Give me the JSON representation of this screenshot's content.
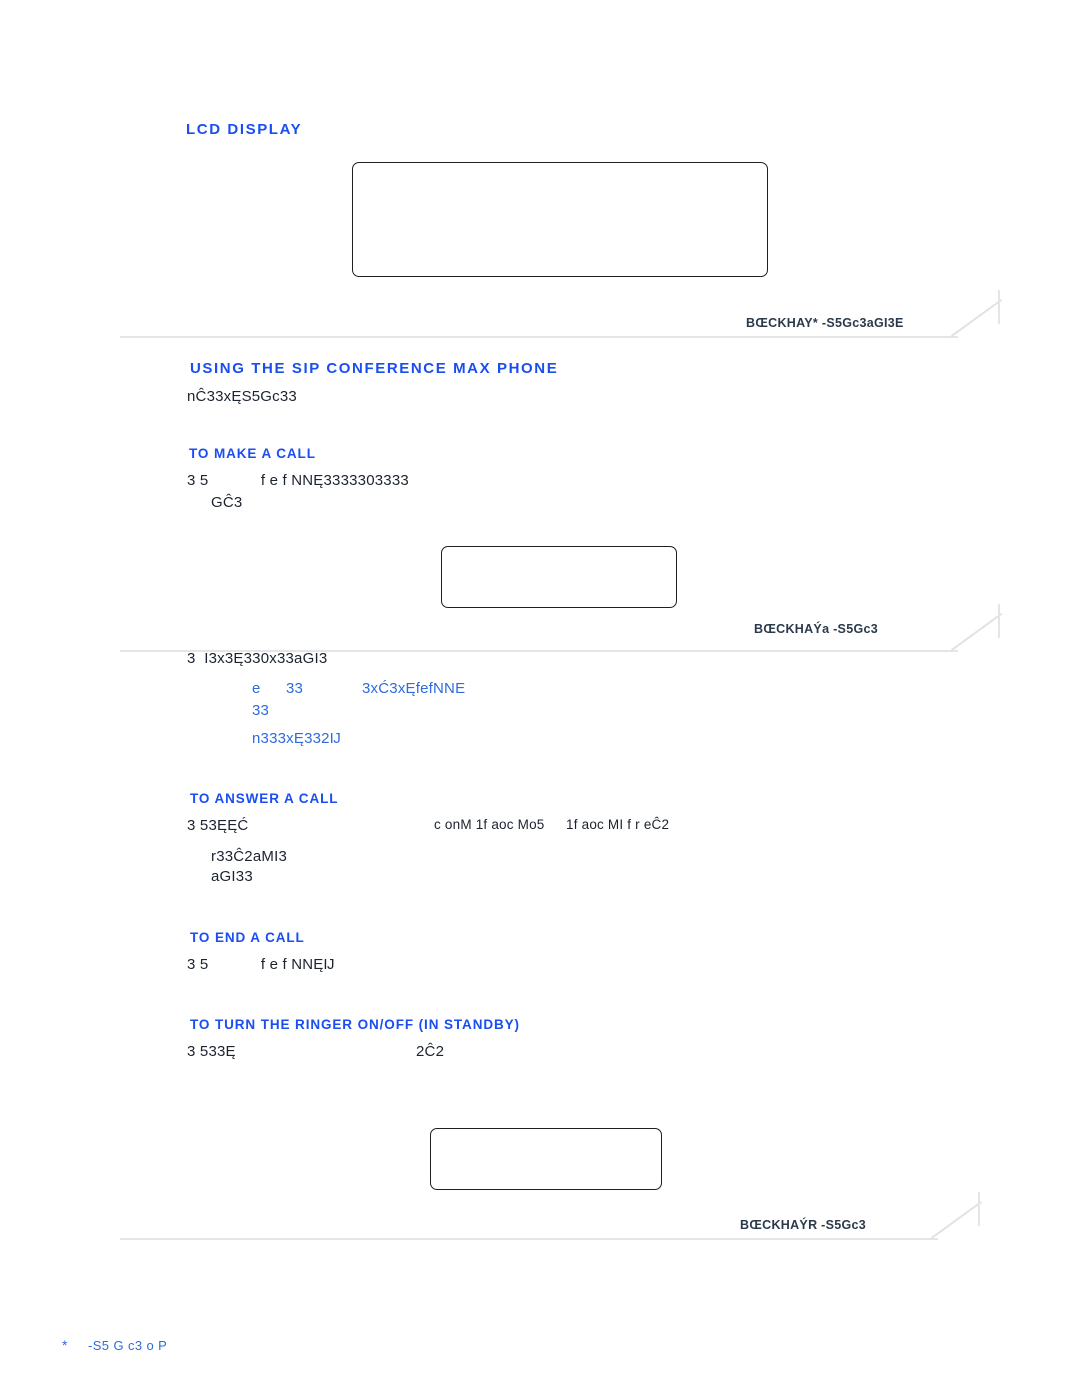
{
  "page": {
    "background": "#ffffff",
    "accent_blue": "#1a4ef0",
    "body_blue": "#2f6bdd",
    "body_dark": "#1c2330",
    "rule_grey": "#e3e6e6",
    "box_border": "#231f20"
  },
  "sections": {
    "lcd_display": {
      "heading": "LCD DISPLAY",
      "figure_caption": "BŒCKHAY* -S5Gc3aGI3E"
    },
    "using_phone": {
      "heading": "USING THE SIP CONFERENCE MAX PHONE",
      "intro": "nĈ33xĘS5Gc33"
    },
    "to_make_a_call": {
      "heading": "TO MAKE A CALL",
      "line1": "3 5            f e f NNĘ3333303333",
      "line2": "GĈ3",
      "figure_caption": "BŒCKHAÝa -S5Gc3",
      "line3": "3  I3x3Ę330x33aGI3",
      "line4_bullet": "e",
      "line4_mid": "33",
      "line4_right": "3xĆ3xĘfefNNE",
      "line5": "33",
      "line6": "n333xĘ332Ĳ"
    },
    "to_answer_a_call": {
      "heading": "TO ANSWER A CALL",
      "line1_left": "3 53ĘĘĆ",
      "line1_mid": "c onM 1f aoc Mo5",
      "line1_right": "1f aoc MI f r eĈ2",
      "line2": "r33Ĉ2aMI3",
      "line3": "aGI33"
    },
    "to_end_a_call": {
      "heading": "TO END A CALL",
      "line1": "3 5            f e f NNĘĲ"
    },
    "to_turn_ringer": {
      "heading": "TO TURN THE RINGER ON/OFF (IN STANDBY)",
      "line1_left": "3 533Ę",
      "line1_right": "2Ĉ2",
      "figure_caption": "BŒCKHAÝR -S5Gc3"
    }
  },
  "footer": {
    "marker": "*",
    "text": "-S5 G c3 o P"
  }
}
